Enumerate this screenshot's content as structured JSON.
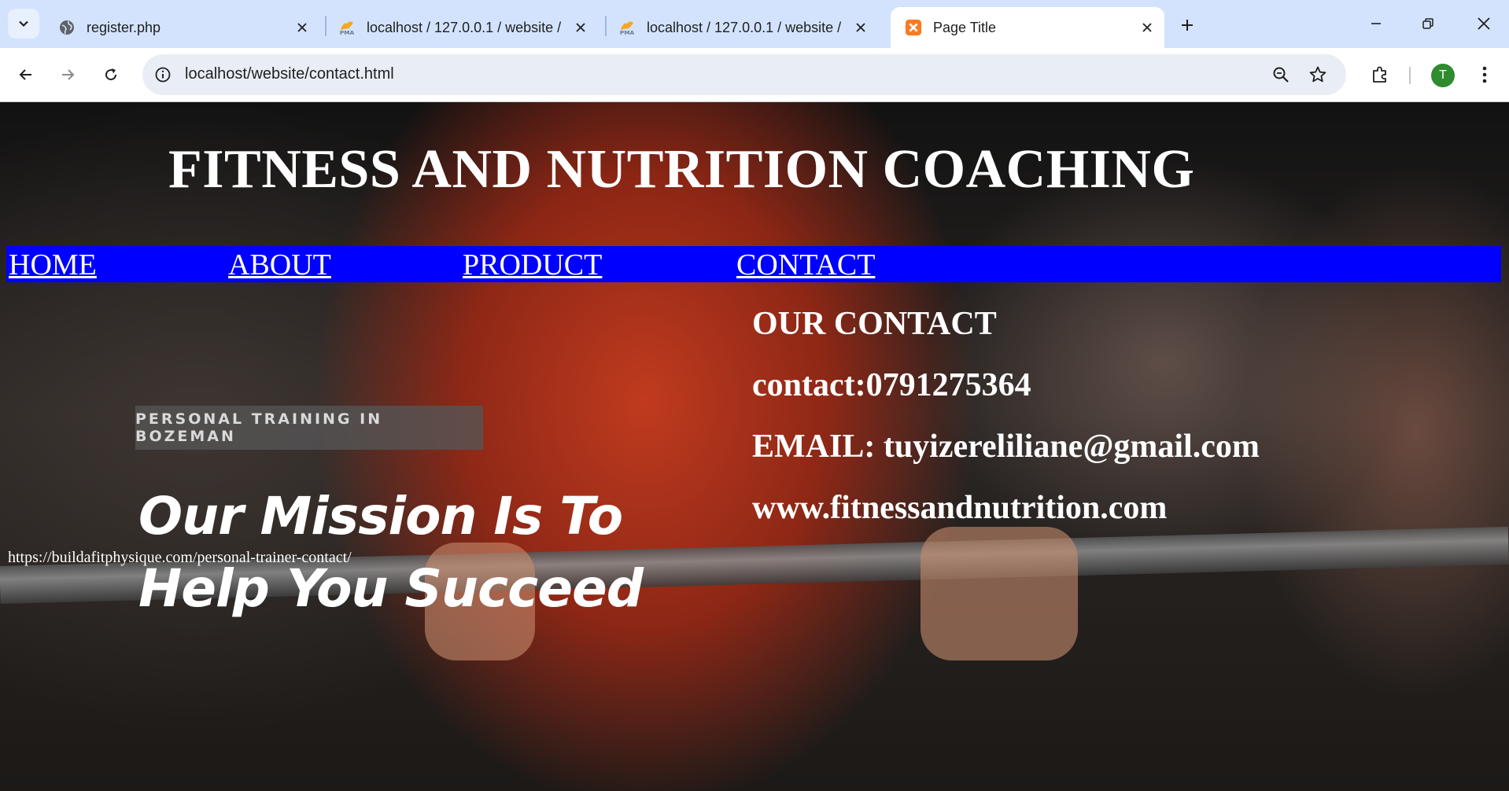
{
  "browser": {
    "tabs": [
      {
        "title": "register.php",
        "icon": "globe-icon"
      },
      {
        "title": "localhost / 127.0.0.1 / website /",
        "icon": "phpmyadmin-icon"
      },
      {
        "title": "localhost / 127.0.0.1 / website /",
        "icon": "phpmyadmin-icon"
      },
      {
        "title": "Page Title",
        "icon": "xampp-icon",
        "active": true
      }
    ],
    "address": "localhost/website/contact.html",
    "profile_initial": "T",
    "colors": {
      "tabbar": "#d3e3fd",
      "profile": "#2e8b2e"
    }
  },
  "page": {
    "site_title": "FITNESS AND NUTRITION COACHING",
    "nav": [
      "HOME",
      "ABOUT",
      "PRODUCT",
      "CONTACT"
    ],
    "contact": {
      "heading": "OUR CONTACT",
      "phone": "contact:0791275364",
      "email": "EMAIL: tuyizereliliane@gmail.com",
      "website": "www.fitnessandnutrition.com"
    },
    "image_text": {
      "badge": "PERSONAL TRAINING IN BOZEMAN",
      "mission_line1": "Our Mission Is To",
      "mission_line2": "Help You Succeed"
    },
    "image_caption": "https://buildafitphysique.com/personal-trainer-contact/",
    "colors": {
      "nav_bg": "#0000ff",
      "text": "#ffffff"
    }
  }
}
